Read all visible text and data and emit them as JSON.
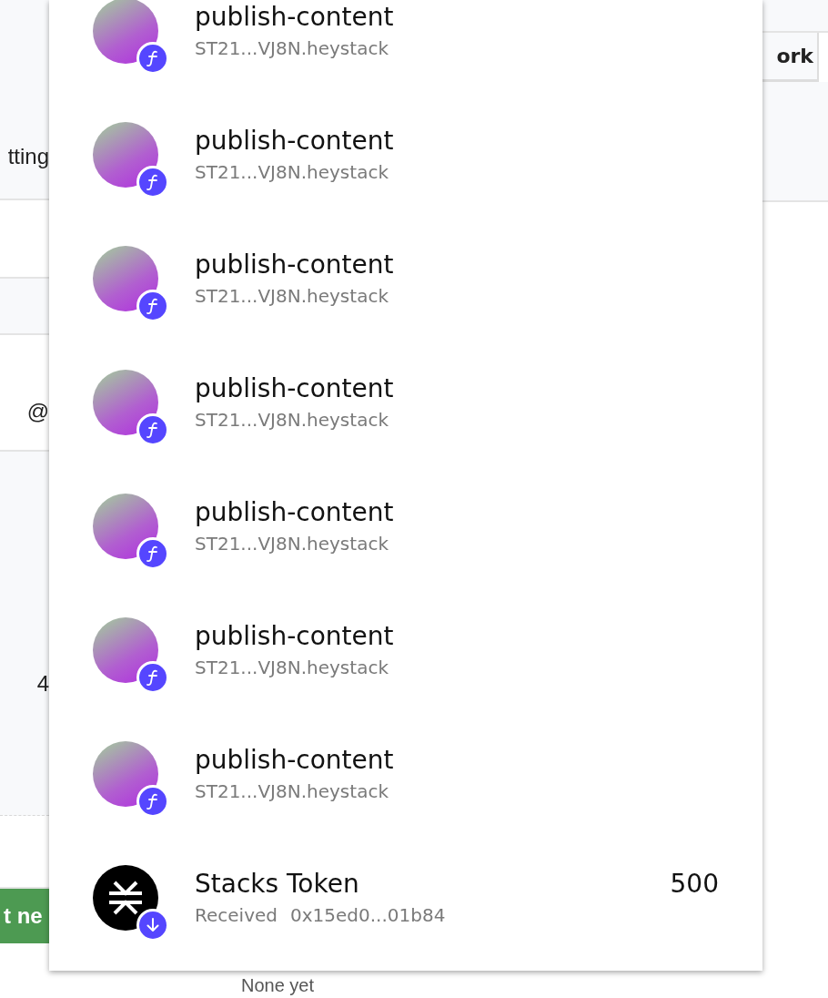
{
  "background": {
    "left_texts": [
      "tting",
      "@",
      "4"
    ],
    "left_button": "t ne",
    "right_tab": "ork",
    "empty_text": "None yet"
  },
  "activity": [
    {
      "kind": "contract",
      "title": "publish-content",
      "subtitle": "ST21...VJ8N.heystack"
    },
    {
      "kind": "contract",
      "title": "publish-content",
      "subtitle": "ST21...VJ8N.heystack"
    },
    {
      "kind": "contract",
      "title": "publish-content",
      "subtitle": "ST21...VJ8N.heystack"
    },
    {
      "kind": "contract",
      "title": "publish-content",
      "subtitle": "ST21...VJ8N.heystack"
    },
    {
      "kind": "contract",
      "title": "publish-content",
      "subtitle": "ST21...VJ8N.heystack"
    },
    {
      "kind": "contract",
      "title": "publish-content",
      "subtitle": "ST21...VJ8N.heystack"
    },
    {
      "kind": "contract",
      "title": "publish-content",
      "subtitle": "ST21...VJ8N.heystack"
    },
    {
      "kind": "token",
      "title": "Stacks Token",
      "status": "Received",
      "subtitle": "0x15ed0...01b84",
      "amount": "500"
    }
  ]
}
